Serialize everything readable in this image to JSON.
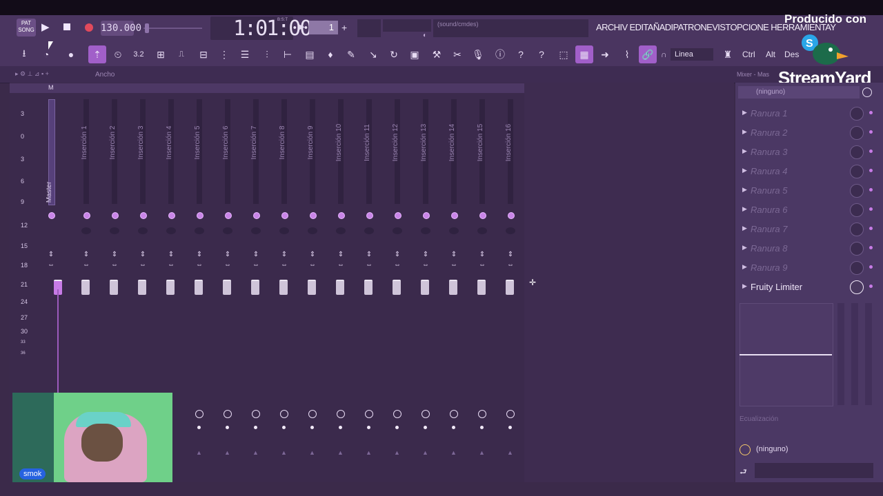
{
  "app": "FL Studio Mixer",
  "transport": {
    "pat_label": "PAT",
    "song_label": "SONG",
    "tempo": "130.000",
    "time": "1:01:00",
    "time_label": "B:S:T",
    "pattern_number": "1",
    "hint_text": "(sound/cmdes)"
  },
  "menu": {
    "text": "ARCHIV EDITAÑADIPATRONEVISTOPCIONE HERRAMIENTAY"
  },
  "toolbar": {
    "mode_label": "Linea",
    "keys": [
      "Ctrl",
      "Alt",
      "Des"
    ]
  },
  "subbar": {
    "label": "Ancho",
    "mixer_label": "Mixer - Mas"
  },
  "watermark": {
    "produced_by": "Producido con",
    "brand": "StreamYard"
  },
  "mixer": {
    "scale": [
      "3",
      "0",
      "3",
      "6",
      "9",
      "12",
      "15",
      "18",
      "21",
      "24",
      "27",
      "30",
      "33",
      "36"
    ],
    "master_label": "Master",
    "inserts": [
      "Inserción 1",
      "Inserción 2",
      "Inserción 3",
      "Inserción 4",
      "Inserción 5",
      "Inserción 6",
      "Inserción 7",
      "Inserción 8",
      "Inserción 9",
      "Inserción 10",
      "Inserción 11",
      "Inserción 12",
      "Inserción 13",
      "Inserción 14",
      "Inserción 15",
      "Inserción 16"
    ]
  },
  "right_panel": {
    "header": "(ninguno)",
    "slots": [
      "Ranura 1",
      "Ranura 2",
      "Ranura 3",
      "Ranura 4",
      "Ranura 5",
      "Ranura 6",
      "Ranura 7",
      "Ranura 8",
      "Ranura 9"
    ],
    "active_slot": "Fruity Limiter",
    "eq_label": "Ecualización",
    "output": "(ninguno)"
  },
  "webcam": {
    "name": "smok"
  },
  "colors": {
    "accent": "#c77be6",
    "background": "#3b2a4a",
    "toolbar": "#4a3560"
  }
}
